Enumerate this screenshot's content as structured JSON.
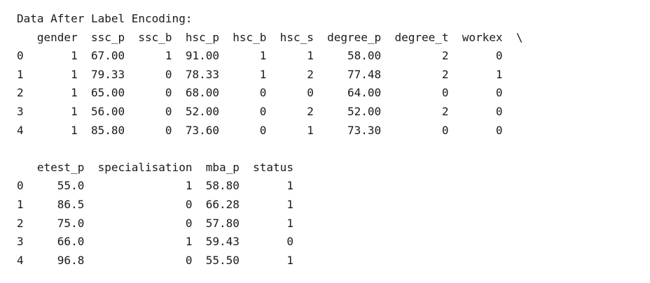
{
  "output": {
    "heading": "Data After Label Encoding:",
    "table1": {
      "header": "   gender  ssc_p  ssc_b  hsc_p  hsc_b  hsc_s  degree_p  degree_t  workex  \\",
      "rows": [
        "0       1  67.00      1  91.00      1      1     58.00         2       0",
        "1       1  79.33      0  78.33      1      2     77.48         2       1",
        "2       1  65.00      0  68.00      0      0     64.00         0       0",
        "3       1  56.00      0  52.00      0      2     52.00         2       0",
        "4       1  85.80      0  73.60      0      1     73.30         0       0"
      ]
    },
    "table2": {
      "header": "   etest_p  specialisation  mba_p  status",
      "rows": [
        "0     55.0               1  58.80       1",
        "1     86.5               0  66.28       1",
        "2     75.0               0  57.80       1",
        "3     66.0               1  59.43       0",
        "4     96.8               0  55.50       1"
      ]
    }
  }
}
